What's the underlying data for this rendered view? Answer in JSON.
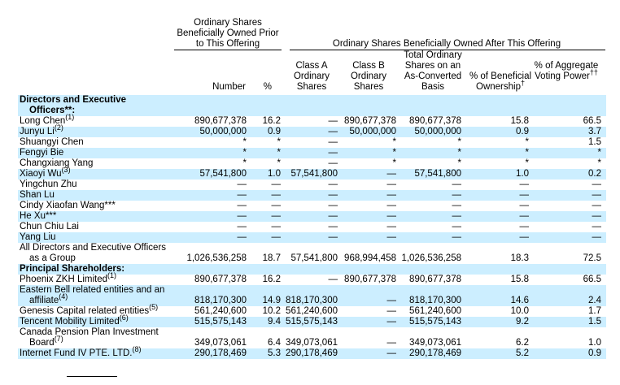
{
  "headers": {
    "prior_group": "Ordinary Shares Beneficially Owned Prior to This Offering",
    "after_group": "Ordinary Shares Beneficially Owned After This Offering",
    "number": "Number",
    "pct": "%",
    "class_a": "Class A Ordinary Shares",
    "class_b": "Class B Ordinary Shares",
    "total": "Total Ordinary Shares on an As-Converted Basis",
    "beneficial": "% of Beneficial Ownership",
    "beneficial_mark": "†",
    "voting": "% of Aggregate Voting Power",
    "voting_mark": "††"
  },
  "rows": [
    {
      "label": "Directors and Executive",
      "bold": true,
      "band": true
    },
    {
      "label": "Officers**:",
      "bold": true,
      "band": true,
      "indent": true
    },
    {
      "label": "Long Chen",
      "sup": "(1)",
      "num": "890,677,378",
      "pct": "16.2",
      "a": "—",
      "b": "890,677,378",
      "total": "890,677,378",
      "ben": "15.8",
      "vote": "66.5"
    },
    {
      "label": "Junyu Li",
      "sup": "(2)",
      "num": "50,000,000",
      "pct": "0.9",
      "a": "—",
      "b": "50,000,000",
      "total": "50,000,000",
      "ben": "0.9",
      "vote": "3.7",
      "band": true
    },
    {
      "label": "Shuangyi Chen",
      "num": "*",
      "pct": "*",
      "a": "—",
      "b": "*",
      "total": "*",
      "ben": "*",
      "vote": "1.5"
    },
    {
      "label": "Fengyi Bie",
      "num": "*",
      "pct": "*",
      "a": "—",
      "b": "*",
      "total": "*",
      "ben": "*",
      "vote": "*",
      "band": true
    },
    {
      "label": "Changxiang Yang",
      "num": "*",
      "pct": "*",
      "a": "—",
      "b": "*",
      "total": "*",
      "ben": "*",
      "vote": "*"
    },
    {
      "label": "Xiaoyi Wu",
      "sup": "(3)",
      "num": "57,541,800",
      "pct": "1.0",
      "a": "57,541,800",
      "b": "—",
      "total": "57,541,800",
      "ben": "1.0",
      "vote": "0.2",
      "band": true
    },
    {
      "label": "Yingchun Zhu",
      "num": "—",
      "pct": "—",
      "a": "—",
      "b": "—",
      "total": "—",
      "ben": "—",
      "vote": "—"
    },
    {
      "label": "Shan Lu",
      "num": "—",
      "pct": "—",
      "a": "—",
      "b": "—",
      "total": "—",
      "ben": "—",
      "vote": "—",
      "band": true
    },
    {
      "label": "Cindy Xiaofan Wang***",
      "num": "—",
      "pct": "—",
      "a": "—",
      "b": "—",
      "total": "—",
      "ben": "—",
      "vote": "—"
    },
    {
      "label": "He Xu***",
      "num": "—",
      "pct": "—",
      "a": "—",
      "b": "—",
      "total": "—",
      "ben": "—",
      "vote": "—",
      "band": true
    },
    {
      "label": "Chun Chiu Lai",
      "num": "—",
      "pct": "—",
      "a": "—",
      "b": "—",
      "total": "—",
      "ben": "—",
      "vote": "—"
    },
    {
      "label": "Yang Liu",
      "num": "—",
      "pct": "—",
      "a": "—",
      "b": "—",
      "total": "—",
      "ben": "—",
      "vote": "—",
      "band": true
    },
    {
      "label": "All Directors and Executive Officers"
    },
    {
      "label": "as a Group",
      "indent": true,
      "num": "1,026,536,258",
      "pct": "18.7",
      "a": "57,541,800",
      "b": "968,994,458",
      "total": "1,026,536,258",
      "ben": "18.3",
      "vote": "72.5"
    },
    {
      "label": "Principal Shareholders:",
      "bold": true,
      "band": true
    },
    {
      "label": "Phoenix ZKH Limited",
      "sup": "(1)",
      "num": "890,677,378",
      "pct": "16.2",
      "a": "—",
      "b": "890,677,378",
      "total": "890,677,378",
      "ben": "15.8",
      "vote": "66.5"
    },
    {
      "label": "Eastern Bell related entities and an",
      "band": true
    },
    {
      "label": "affiliate",
      "sup": "(4)",
      "indent": true,
      "num": "818,170,300",
      "pct": "14.9",
      "a": "818,170,300",
      "b": "—",
      "total": "818,170,300",
      "ben": "14.6",
      "vote": "2.4",
      "band": true
    },
    {
      "label": "Genesis Capital related entities",
      "sup": "(5)",
      "num": "561,240,600",
      "pct": "10.2",
      "a": "561,240,600",
      "b": "—",
      "total": "561,240,600",
      "ben": "10.0",
      "vote": "1.7"
    },
    {
      "label": "Tencent Mobility Limited",
      "sup": "(6)",
      "num": "515,575,143",
      "pct": "9.4",
      "a": "515,575,143",
      "b": "—",
      "total": "515,575,143",
      "ben": "9.2",
      "vote": "1.5",
      "band": true
    },
    {
      "label": "Canada Pension Plan Investment"
    },
    {
      "label": "Board",
      "sup": "(7)",
      "indent": true,
      "num": "349,073,061",
      "pct": "6.4",
      "a": "349,073,061",
      "b": "—",
      "total": "349,073,061",
      "ben": "6.2",
      "vote": "1.0"
    },
    {
      "label": "Internet Fund IV PTE. LTD.",
      "sup": "(8)",
      "num": "290,178,469",
      "pct": "5.3",
      "a": "290,178,469",
      "b": "—",
      "total": "290,178,469",
      "ben": "5.2",
      "vote": "0.9",
      "band": true
    }
  ]
}
